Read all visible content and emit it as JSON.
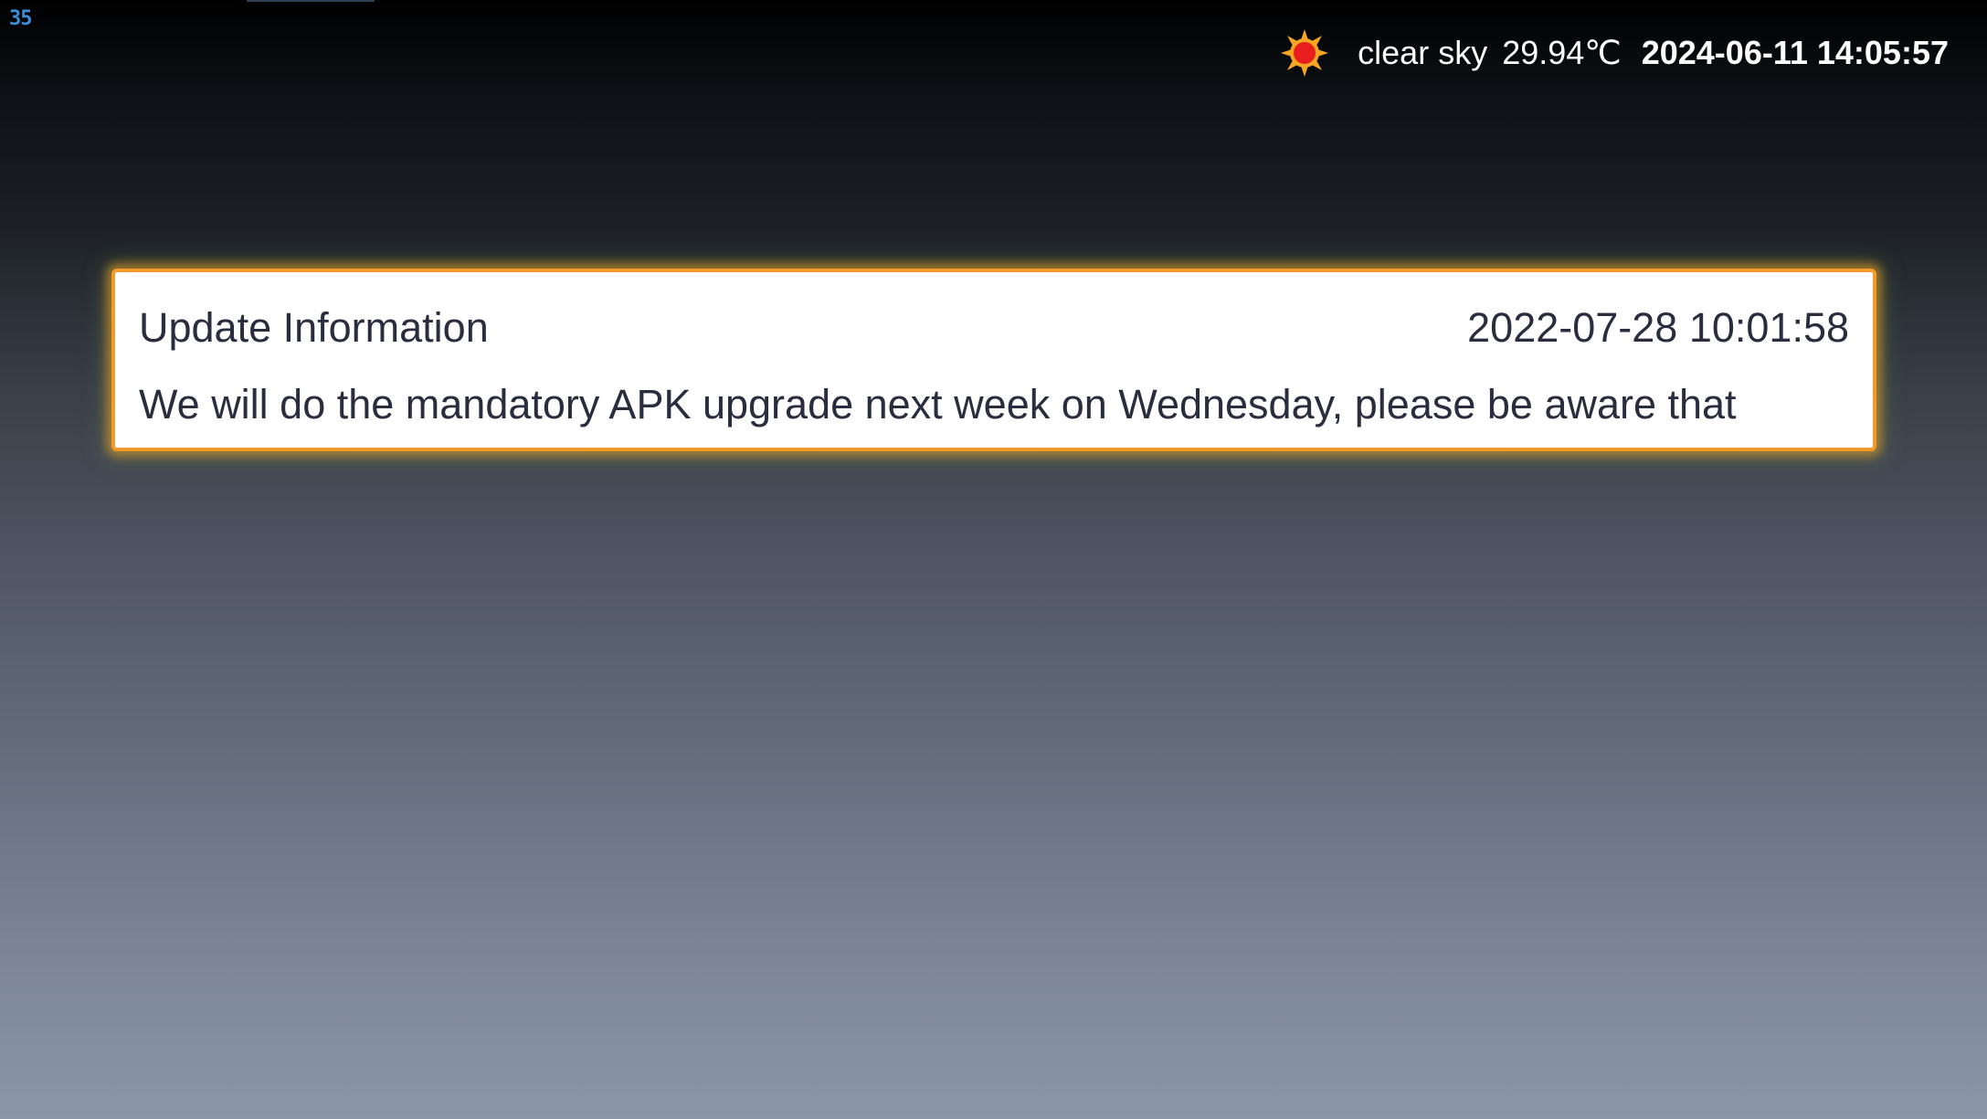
{
  "corner": {
    "counter": "35"
  },
  "status": {
    "weather_icon": "sun-icon",
    "weather_desc": "clear sky",
    "temperature": "29.94℃",
    "datetime": "2024-06-11 14:05:57"
  },
  "notice": {
    "title": "Update Information",
    "date": "2022-07-28 10:01:58",
    "body": "We will do the mandatory APK upgrade next week on Wednesday, please be aware that",
    "border_color": "#f39a2a"
  }
}
